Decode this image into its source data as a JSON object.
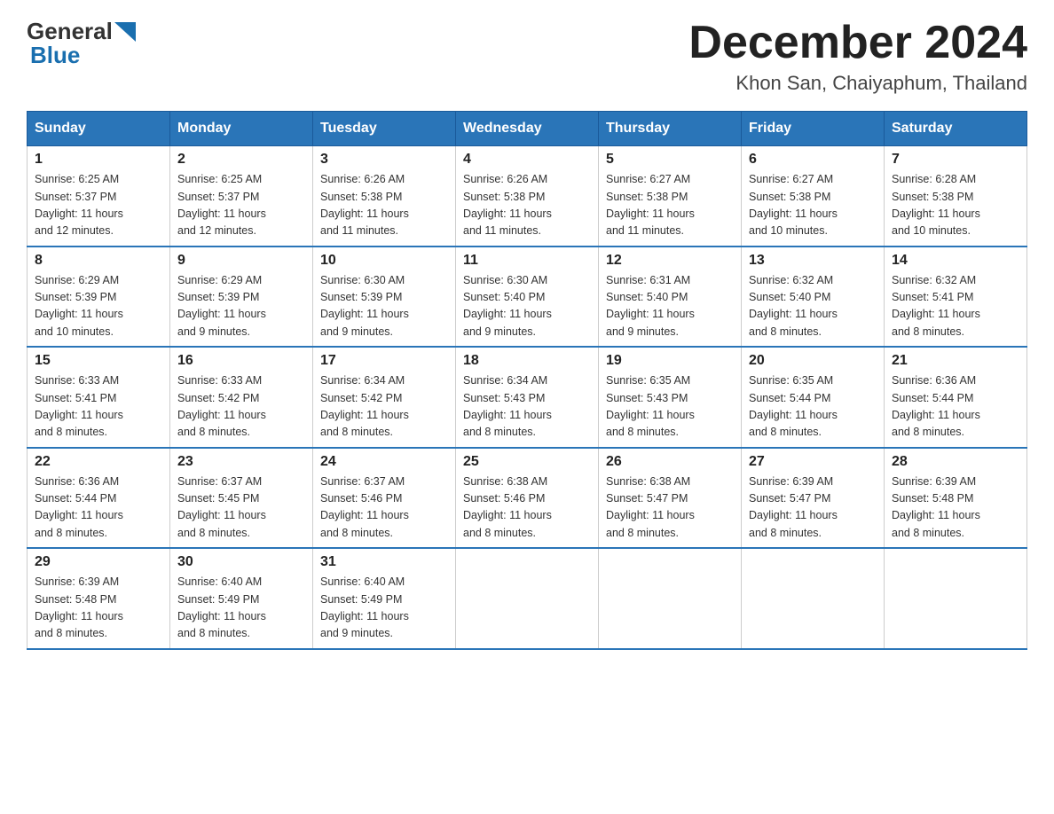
{
  "header": {
    "logo_line1": "General",
    "logo_arrow": "▶",
    "logo_line2": "Blue",
    "title": "December 2024",
    "subtitle": "Khon San, Chaiyaphum, Thailand"
  },
  "days_of_week": [
    "Sunday",
    "Monday",
    "Tuesday",
    "Wednesday",
    "Thursday",
    "Friday",
    "Saturday"
  ],
  "weeks": [
    [
      {
        "num": "1",
        "sunrise": "6:25 AM",
        "sunset": "5:37 PM",
        "daylight": "11 hours and 12 minutes."
      },
      {
        "num": "2",
        "sunrise": "6:25 AM",
        "sunset": "5:37 PM",
        "daylight": "11 hours and 12 minutes."
      },
      {
        "num": "3",
        "sunrise": "6:26 AM",
        "sunset": "5:38 PM",
        "daylight": "11 hours and 11 minutes."
      },
      {
        "num": "4",
        "sunrise": "6:26 AM",
        "sunset": "5:38 PM",
        "daylight": "11 hours and 11 minutes."
      },
      {
        "num": "5",
        "sunrise": "6:27 AM",
        "sunset": "5:38 PM",
        "daylight": "11 hours and 11 minutes."
      },
      {
        "num": "6",
        "sunrise": "6:27 AM",
        "sunset": "5:38 PM",
        "daylight": "11 hours and 10 minutes."
      },
      {
        "num": "7",
        "sunrise": "6:28 AM",
        "sunset": "5:38 PM",
        "daylight": "11 hours and 10 minutes."
      }
    ],
    [
      {
        "num": "8",
        "sunrise": "6:29 AM",
        "sunset": "5:39 PM",
        "daylight": "11 hours and 10 minutes."
      },
      {
        "num": "9",
        "sunrise": "6:29 AM",
        "sunset": "5:39 PM",
        "daylight": "11 hours and 9 minutes."
      },
      {
        "num": "10",
        "sunrise": "6:30 AM",
        "sunset": "5:39 PM",
        "daylight": "11 hours and 9 minutes."
      },
      {
        "num": "11",
        "sunrise": "6:30 AM",
        "sunset": "5:40 PM",
        "daylight": "11 hours and 9 minutes."
      },
      {
        "num": "12",
        "sunrise": "6:31 AM",
        "sunset": "5:40 PM",
        "daylight": "11 hours and 9 minutes."
      },
      {
        "num": "13",
        "sunrise": "6:32 AM",
        "sunset": "5:40 PM",
        "daylight": "11 hours and 8 minutes."
      },
      {
        "num": "14",
        "sunrise": "6:32 AM",
        "sunset": "5:41 PM",
        "daylight": "11 hours and 8 minutes."
      }
    ],
    [
      {
        "num": "15",
        "sunrise": "6:33 AM",
        "sunset": "5:41 PM",
        "daylight": "11 hours and 8 minutes."
      },
      {
        "num": "16",
        "sunrise": "6:33 AM",
        "sunset": "5:42 PM",
        "daylight": "11 hours and 8 minutes."
      },
      {
        "num": "17",
        "sunrise": "6:34 AM",
        "sunset": "5:42 PM",
        "daylight": "11 hours and 8 minutes."
      },
      {
        "num": "18",
        "sunrise": "6:34 AM",
        "sunset": "5:43 PM",
        "daylight": "11 hours and 8 minutes."
      },
      {
        "num": "19",
        "sunrise": "6:35 AM",
        "sunset": "5:43 PM",
        "daylight": "11 hours and 8 minutes."
      },
      {
        "num": "20",
        "sunrise": "6:35 AM",
        "sunset": "5:44 PM",
        "daylight": "11 hours and 8 minutes."
      },
      {
        "num": "21",
        "sunrise": "6:36 AM",
        "sunset": "5:44 PM",
        "daylight": "11 hours and 8 minutes."
      }
    ],
    [
      {
        "num": "22",
        "sunrise": "6:36 AM",
        "sunset": "5:44 PM",
        "daylight": "11 hours and 8 minutes."
      },
      {
        "num": "23",
        "sunrise": "6:37 AM",
        "sunset": "5:45 PM",
        "daylight": "11 hours and 8 minutes."
      },
      {
        "num": "24",
        "sunrise": "6:37 AM",
        "sunset": "5:46 PM",
        "daylight": "11 hours and 8 minutes."
      },
      {
        "num": "25",
        "sunrise": "6:38 AM",
        "sunset": "5:46 PM",
        "daylight": "11 hours and 8 minutes."
      },
      {
        "num": "26",
        "sunrise": "6:38 AM",
        "sunset": "5:47 PM",
        "daylight": "11 hours and 8 minutes."
      },
      {
        "num": "27",
        "sunrise": "6:39 AM",
        "sunset": "5:47 PM",
        "daylight": "11 hours and 8 minutes."
      },
      {
        "num": "28",
        "sunrise": "6:39 AM",
        "sunset": "5:48 PM",
        "daylight": "11 hours and 8 minutes."
      }
    ],
    [
      {
        "num": "29",
        "sunrise": "6:39 AM",
        "sunset": "5:48 PM",
        "daylight": "11 hours and 8 minutes."
      },
      {
        "num": "30",
        "sunrise": "6:40 AM",
        "sunset": "5:49 PM",
        "daylight": "11 hours and 8 minutes."
      },
      {
        "num": "31",
        "sunrise": "6:40 AM",
        "sunset": "5:49 PM",
        "daylight": "11 hours and 9 minutes."
      },
      null,
      null,
      null,
      null
    ]
  ],
  "sunrise_label": "Sunrise:",
  "sunset_label": "Sunset:",
  "daylight_label": "Daylight:"
}
